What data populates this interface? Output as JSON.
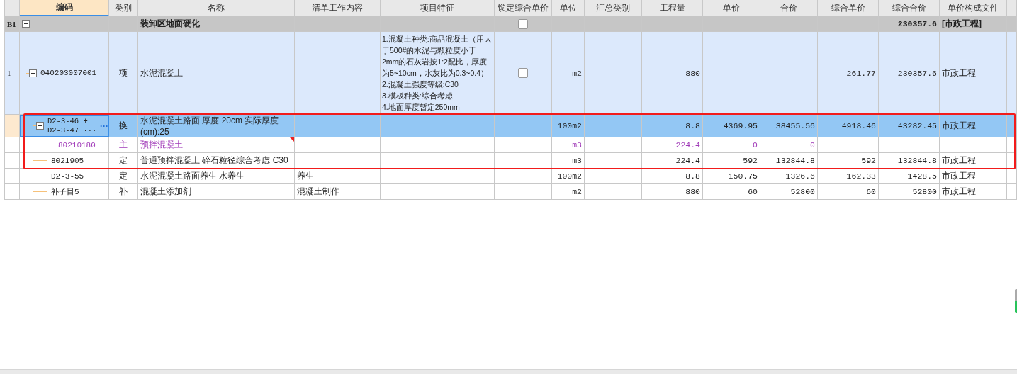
{
  "columns": [
    {
      "label": "编码",
      "selected": true
    },
    {
      "label": "类别",
      "selected": false
    },
    {
      "label": "名称",
      "selected": false
    },
    {
      "label": "清单工作内容",
      "selected": false
    },
    {
      "label": "项目特征",
      "selected": false
    },
    {
      "label": "锁定综合单价",
      "selected": false
    },
    {
      "label": "单位",
      "selected": false
    },
    {
      "label": "汇总类别",
      "selected": false
    },
    {
      "label": "工程量",
      "selected": false
    },
    {
      "label": "单价",
      "selected": false
    },
    {
      "label": "合价",
      "selected": false
    },
    {
      "label": "综合单价",
      "selected": false
    },
    {
      "label": "综合合价",
      "selected": false
    },
    {
      "label": "单价构成文件",
      "selected": false
    }
  ],
  "rows": [
    {
      "kind": "section",
      "number": "B1",
      "expanded": true,
      "selected": false,
      "flagged": false,
      "highlighted": false,
      "name": "装卸区地面硬化",
      "locked": false,
      "comp_total": "230357.6",
      "price_file": "[市政工程]",
      "children": [
        {
          "kind": "item",
          "number": "1",
          "code": "040203007001",
          "expanded": true,
          "selected": false,
          "flagged": false,
          "highlighted": false,
          "type": "项",
          "name": "水泥混凝土",
          "features": "1.混凝土种类:商品混凝土（用大于500#的水泥与颗粒度小于2mm的石灰岩按1:2配比，厚度为5~10cm，水灰比为0.3~0.4）\n2.混凝土强度等级:C30\n3.模板种类:综合考虑\n4.地面厚度暂定250mm",
          "locked": false,
          "unit": "m2",
          "quantity": "880",
          "comp_unit_price": "261.77",
          "comp_total": "230357.6",
          "price_file": "市政工程",
          "children": [
            {
              "kind": "quota",
              "code": "D2-3-46 + D2-3-47 ···",
              "more_button": "···",
              "expanded": true,
              "selected": true,
              "flagged": false,
              "highlighted": true,
              "type": "换",
              "name": "水泥混凝土路面 厚度 20cm  实际厚度(cm):25",
              "unit": "100m2",
              "quantity": "8.8",
              "unit_price": "4369.95",
              "total": "38455.56",
              "comp_unit_price": "4918.46",
              "comp_total": "43282.45",
              "price_file": "市政工程",
              "children": [
                {
                  "kind": "material",
                  "code": "80210180",
                  "selected": false,
                  "flagged": true,
                  "highlighted": true,
                  "type": "主",
                  "name": "预拌混凝土",
                  "unit": "m3",
                  "quantity": "224.4",
                  "unit_price": "0",
                  "total": "0"
                }
              ]
            },
            {
              "kind": "quota",
              "code": "8021905",
              "selected": false,
              "flagged": false,
              "highlighted": true,
              "type": "定",
              "name": "普通预拌混凝土 碎石粒径综合考虑 C30",
              "unit": "m3",
              "quantity": "224.4",
              "unit_price": "592",
              "total": "132844.8",
              "comp_unit_price": "592",
              "comp_total": "132844.8",
              "price_file": "市政工程"
            },
            {
              "kind": "quota",
              "code": "D2-3-55",
              "selected": false,
              "flagged": false,
              "highlighted": false,
              "type": "定",
              "name": "水泥混凝土路面养生 水养生",
              "work_content": "养生",
              "unit": "100m2",
              "quantity": "8.8",
              "unit_price": "150.75",
              "total": "1326.6",
              "comp_unit_price": "162.33",
              "comp_total": "1428.5",
              "price_file": "市政工程"
            },
            {
              "kind": "quota",
              "code": "补子目5",
              "selected": false,
              "flagged": false,
              "highlighted": false,
              "type": "补",
              "name": "混凝土添加剂",
              "work_content": "混凝土制作",
              "unit": "m2",
              "quantity": "880",
              "unit_price": "60",
              "total": "52800",
              "comp_unit_price": "60",
              "comp_total": "52800",
              "price_file": "市政工程"
            }
          ]
        }
      ]
    }
  ]
}
